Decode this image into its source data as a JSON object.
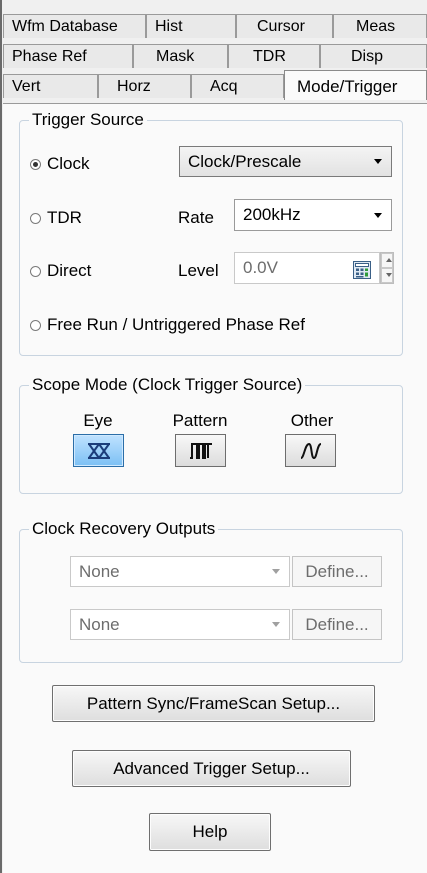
{
  "tabs": {
    "row1": [
      {
        "label": "Wfm Database"
      },
      {
        "label": "Hist"
      },
      {
        "label": "Cursor"
      },
      {
        "label": "Meas"
      }
    ],
    "row2": [
      {
        "label": "Phase Ref"
      },
      {
        "label": "Mask"
      },
      {
        "label": "TDR"
      },
      {
        "label": "Disp"
      }
    ],
    "row3": [
      {
        "label": "Vert"
      },
      {
        "label": "Horz"
      },
      {
        "label": "Acq"
      },
      {
        "label": "Mode/Trigger",
        "active": true
      }
    ]
  },
  "trigger_source": {
    "title": "Trigger Source",
    "options": {
      "clock": {
        "label": "Clock",
        "checked": true
      },
      "tdr": {
        "label": "TDR",
        "checked": false
      },
      "direct": {
        "label": "Direct",
        "checked": false
      },
      "free_run": {
        "label": "Free Run / Untriggered Phase Ref",
        "checked": false
      }
    },
    "clock_select": {
      "value": "Clock/Prescale"
    },
    "rate": {
      "label": "Rate",
      "value": "200kHz"
    },
    "level": {
      "label": "Level",
      "value": "0.0V"
    }
  },
  "scope_mode": {
    "title": "Scope Mode (Clock Trigger Source)",
    "modes": [
      {
        "label": "Eye",
        "icon": "eye-diagram-icon",
        "active": true
      },
      {
        "label": "Pattern",
        "icon": "pattern-waveform-icon",
        "active": false
      },
      {
        "label": "Other",
        "icon": "sine-wave-icon",
        "active": false
      }
    ]
  },
  "clock_recovery": {
    "title": "Clock Recovery Outputs",
    "outputs": [
      {
        "value": "None",
        "define_label": "Define..."
      },
      {
        "value": "None",
        "define_label": "Define..."
      }
    ]
  },
  "buttons": {
    "pattern_sync": "Pattern Sync/FrameScan Setup...",
    "advanced_trigger": "Advanced Trigger Setup...",
    "help": "Help"
  },
  "colors": {
    "active_mode": "#7cc0f4",
    "panel_bg": "#fafafa",
    "group_border": "#c8d4e0"
  }
}
